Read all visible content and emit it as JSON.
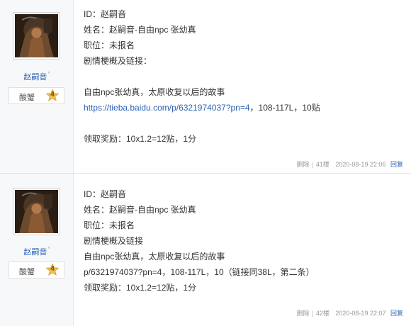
{
  "posts": [
    {
      "author": {
        "name": "赵嗣音",
        "dot": "°",
        "level_name": "酸蟹",
        "level": "4"
      },
      "lines": {
        "id": "ID：赵嗣音",
        "name": "姓名：赵嗣音-自由npc 张幼真",
        "position": "职位：未报名",
        "plot": "剧情梗概及链接：",
        "story": "自由npc张幼真，太原收复以后的故事",
        "link": "https://tieba.baidu.com/p/6321974037?pn=4",
        "link_suffix": "，108-117L，10贴",
        "reward": "领取奖励：10x1.2=12贴，1分"
      },
      "footer": {
        "delete": "删除",
        "sep": "|",
        "floor": "41楼",
        "time": "2020-08-19 22:06",
        "reply": "回复"
      }
    },
    {
      "author": {
        "name": "赵嗣音",
        "dot": "°",
        "level_name": "酸蟹",
        "level": "4"
      },
      "lines": {
        "id": "ID：赵嗣音",
        "name": "姓名：赵嗣音-自由npc 张幼真",
        "position": "职位：未报名",
        "plot": "剧情梗概及链接",
        "story": "自由npc张幼真，太原收复以后的故事",
        "link_text": "p/6321974037?pn=4，108-117L，10（链接同38L，第二条）",
        "reward": "领取奖励：10x1.2=12贴，1分"
      },
      "footer": {
        "delete": "删除",
        "sep": "|",
        "floor": "42楼",
        "time": "2020-08-19 22:07",
        "reply": "回复"
      }
    }
  ],
  "colors": {
    "link": "#2d64b3",
    "sidebar_bg": "#f7f8fa",
    "badge_gold": "#f2c14e"
  },
  "icons": {
    "avatar": "avatar-image",
    "level_badge": "star-level-badge-icon"
  }
}
